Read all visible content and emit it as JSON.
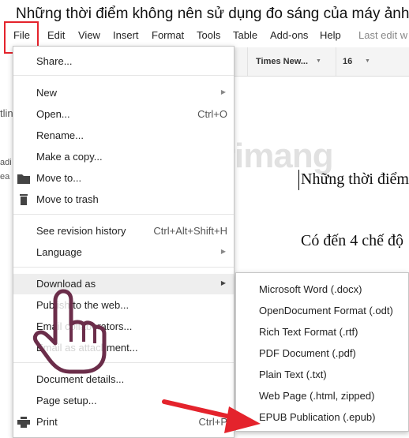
{
  "doc": {
    "title": "Những thời điểm không nên sử dụng đo sáng của máy ảnh.do",
    "body_lines": [
      "Những thời điểm",
      "Có đến 4 chế độ"
    ]
  },
  "menubar": {
    "file": "File",
    "items": [
      "Edit",
      "View",
      "Insert",
      "Format",
      "Tools",
      "Table",
      "Add-ons",
      "Help"
    ],
    "last_edit": "Last edit w"
  },
  "toolbar": {
    "font": "Times New...",
    "size": "16"
  },
  "left_strip": [
    "tlin",
    "adi",
    "ea"
  ],
  "watermark": "uantrimang",
  "file_menu": {
    "share": "Share...",
    "new": "New",
    "open": "Open...",
    "open_shortcut": "Ctrl+O",
    "rename": "Rename...",
    "make_copy": "Make a copy...",
    "move_to": "Move to...",
    "move_trash": "Move to trash",
    "revision_history": "See revision history",
    "revision_shortcut": "Ctrl+Alt+Shift+H",
    "language": "Language",
    "download_as": "Download as",
    "publish": "Publish to the web...",
    "email_collab": "Email collaborators...",
    "email_attach": "Email as attachment...",
    "doc_details": "Document details...",
    "page_setup": "Page setup...",
    "print": "Print",
    "print_shortcut": "Ctrl+P"
  },
  "download_submenu": [
    "Microsoft Word (.docx)",
    "OpenDocument Format (.odt)",
    "Rich Text Format (.rtf)",
    "PDF Document (.pdf)",
    "Plain Text (.txt)",
    "Web Page (.html, zipped)",
    "EPUB Publication (.epub)"
  ],
  "icons": {
    "arrow": "submenu-arrow-icon",
    "folder": "folder-icon",
    "trash": "trash-icon",
    "print": "printer-icon"
  },
  "colors": {
    "highlight_red": "#e4232c",
    "menu_hover": "#eeeeee"
  }
}
